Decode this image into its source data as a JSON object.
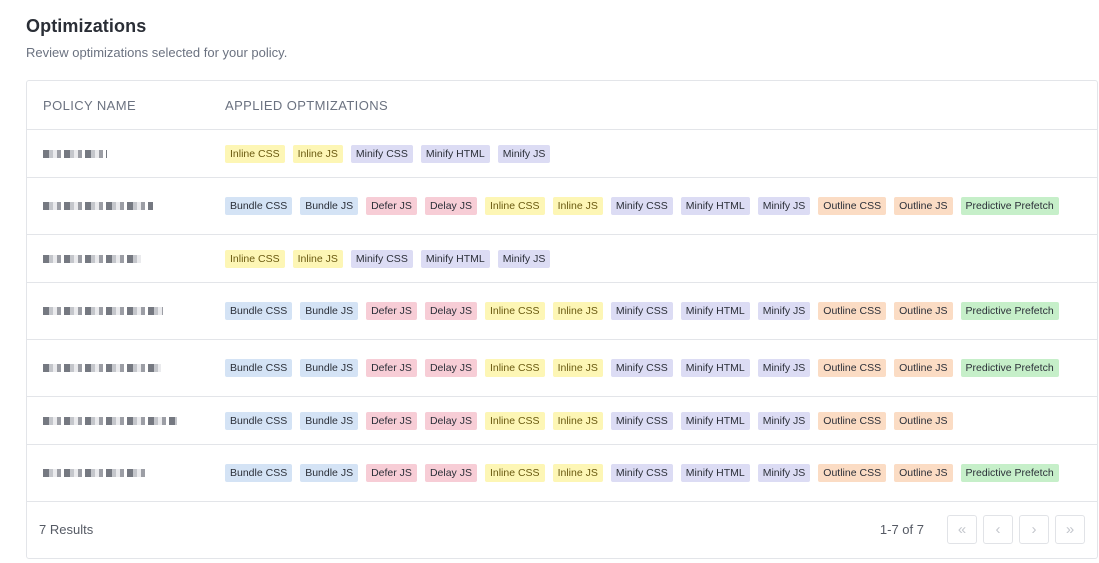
{
  "header": {
    "title": "Optimizations",
    "subtitle": "Review optimizations selected for your policy."
  },
  "table": {
    "columns": [
      "POLICY NAME",
      "APPLIED OPTMIZATIONS"
    ],
    "rows": [
      {
        "name_width": 64,
        "tags": [
          {
            "label": "Inline CSS",
            "kind": "inline"
          },
          {
            "label": "Inline JS",
            "kind": "inline"
          },
          {
            "label": "Minify CSS",
            "kind": "minify"
          },
          {
            "label": "Minify HTML",
            "kind": "minify"
          },
          {
            "label": "Minify JS",
            "kind": "minify"
          }
        ]
      },
      {
        "name_width": 110,
        "tags": [
          {
            "label": "Bundle CSS",
            "kind": "bundle"
          },
          {
            "label": "Bundle JS",
            "kind": "bundle"
          },
          {
            "label": "Defer JS",
            "kind": "defer"
          },
          {
            "label": "Delay JS",
            "kind": "delay"
          },
          {
            "label": "Inline CSS",
            "kind": "inline"
          },
          {
            "label": "Inline JS",
            "kind": "inline"
          },
          {
            "label": "Minify CSS",
            "kind": "minify"
          },
          {
            "label": "Minify HTML",
            "kind": "minify"
          },
          {
            "label": "Minify JS",
            "kind": "minify"
          },
          {
            "label": "Outline CSS",
            "kind": "outline"
          },
          {
            "label": "Outline JS",
            "kind": "outline"
          },
          {
            "label": "Predictive Prefetch",
            "kind": "prefetch"
          }
        ]
      },
      {
        "name_width": 98,
        "tags": [
          {
            "label": "Inline CSS",
            "kind": "inline"
          },
          {
            "label": "Inline JS",
            "kind": "inline"
          },
          {
            "label": "Minify CSS",
            "kind": "minify"
          },
          {
            "label": "Minify HTML",
            "kind": "minify"
          },
          {
            "label": "Minify JS",
            "kind": "minify"
          }
        ]
      },
      {
        "name_width": 120,
        "tags": [
          {
            "label": "Bundle CSS",
            "kind": "bundle"
          },
          {
            "label": "Bundle JS",
            "kind": "bundle"
          },
          {
            "label": "Defer JS",
            "kind": "defer"
          },
          {
            "label": "Delay JS",
            "kind": "delay"
          },
          {
            "label": "Inline CSS",
            "kind": "inline"
          },
          {
            "label": "Inline JS",
            "kind": "inline"
          },
          {
            "label": "Minify CSS",
            "kind": "minify"
          },
          {
            "label": "Minify HTML",
            "kind": "minify"
          },
          {
            "label": "Minify JS",
            "kind": "minify"
          },
          {
            "label": "Outline CSS",
            "kind": "outline"
          },
          {
            "label": "Outline JS",
            "kind": "outline"
          },
          {
            "label": "Predictive Prefetch",
            "kind": "prefetch"
          }
        ]
      },
      {
        "name_width": 118,
        "tags": [
          {
            "label": "Bundle CSS",
            "kind": "bundle"
          },
          {
            "label": "Bundle JS",
            "kind": "bundle"
          },
          {
            "label": "Defer JS",
            "kind": "defer"
          },
          {
            "label": "Delay JS",
            "kind": "delay"
          },
          {
            "label": "Inline CSS",
            "kind": "inline"
          },
          {
            "label": "Inline JS",
            "kind": "inline"
          },
          {
            "label": "Minify CSS",
            "kind": "minify"
          },
          {
            "label": "Minify HTML",
            "kind": "minify"
          },
          {
            "label": "Minify JS",
            "kind": "minify"
          },
          {
            "label": "Outline CSS",
            "kind": "outline"
          },
          {
            "label": "Outline JS",
            "kind": "outline"
          },
          {
            "label": "Predictive Prefetch",
            "kind": "prefetch"
          }
        ]
      },
      {
        "name_width": 134,
        "tags": [
          {
            "label": "Bundle CSS",
            "kind": "bundle"
          },
          {
            "label": "Bundle JS",
            "kind": "bundle"
          },
          {
            "label": "Defer JS",
            "kind": "defer"
          },
          {
            "label": "Delay JS",
            "kind": "delay"
          },
          {
            "label": "Inline CSS",
            "kind": "inline"
          },
          {
            "label": "Inline JS",
            "kind": "inline"
          },
          {
            "label": "Minify CSS",
            "kind": "minify"
          },
          {
            "label": "Minify HTML",
            "kind": "minify"
          },
          {
            "label": "Minify JS",
            "kind": "minify"
          },
          {
            "label": "Outline CSS",
            "kind": "outline"
          },
          {
            "label": "Outline JS",
            "kind": "outline"
          }
        ]
      },
      {
        "name_width": 104,
        "tags": [
          {
            "label": "Bundle CSS",
            "kind": "bundle"
          },
          {
            "label": "Bundle JS",
            "kind": "bundle"
          },
          {
            "label": "Defer JS",
            "kind": "defer"
          },
          {
            "label": "Delay JS",
            "kind": "delay"
          },
          {
            "label": "Inline CSS",
            "kind": "inline"
          },
          {
            "label": "Inline JS",
            "kind": "inline"
          },
          {
            "label": "Minify CSS",
            "kind": "minify"
          },
          {
            "label": "Minify HTML",
            "kind": "minify"
          },
          {
            "label": "Minify JS",
            "kind": "minify"
          },
          {
            "label": "Outline CSS",
            "kind": "outline"
          },
          {
            "label": "Outline JS",
            "kind": "outline"
          },
          {
            "label": "Predictive Prefetch",
            "kind": "prefetch"
          }
        ]
      }
    ]
  },
  "footer": {
    "results": "7 Results",
    "range": "1-7 of 7",
    "buttons": [
      {
        "name": "first-page-button",
        "icon": "double-chevron-left-icon",
        "glyph": "«"
      },
      {
        "name": "prev-page-button",
        "icon": "chevron-left-icon",
        "glyph": "‹"
      },
      {
        "name": "next-page-button",
        "icon": "chevron-right-icon",
        "glyph": "›"
      },
      {
        "name": "last-page-button",
        "icon": "double-chevron-right-icon",
        "glyph": "»"
      }
    ]
  }
}
